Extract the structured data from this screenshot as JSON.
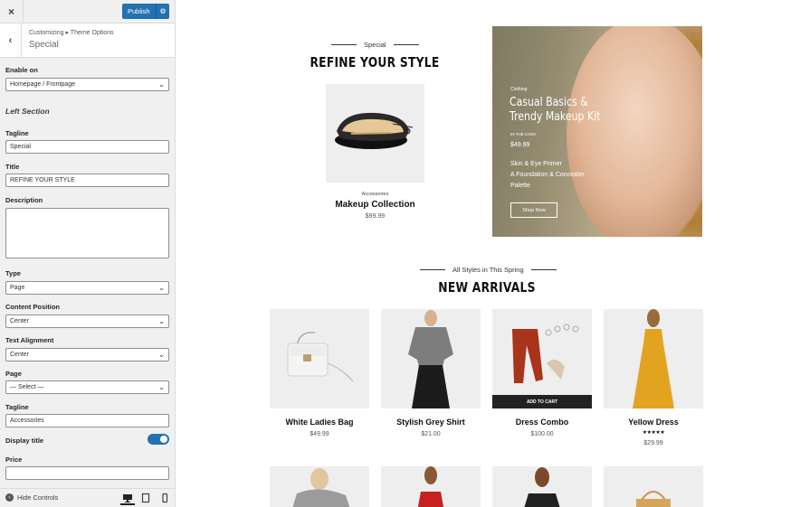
{
  "sidebar": {
    "close_icon": "×",
    "publish_label": "Publish",
    "breadcrumb": "Customizing ▸ Theme Options",
    "section_title": "Special",
    "enable_on": {
      "label": "Enable on",
      "value": "Homepage / Frontpage"
    },
    "left_section_heading": "Left Section",
    "tagline": {
      "label": "Tagline",
      "value": "Special"
    },
    "title": {
      "label": "Title",
      "value": "REFINE YOUR STYLE"
    },
    "description": {
      "label": "Description",
      "value": ""
    },
    "type": {
      "label": "Type",
      "value": "Page"
    },
    "content_position": {
      "label": "Content Position",
      "value": "Center"
    },
    "text_alignment": {
      "label": "Text Alignment",
      "value": "Center"
    },
    "page": {
      "label": "Page",
      "value": "— Select —"
    },
    "tagline2": {
      "label": "Tagline",
      "value": "Accessories"
    },
    "display_title": {
      "label": "Display title",
      "on": true
    },
    "price": {
      "label": "Price",
      "value": ""
    },
    "hide_controls": "Hide Controls"
  },
  "preview": {
    "special_tagline": "Special",
    "special_heading": "REFINE YOUR STYLE",
    "featured": {
      "category": "Accessories",
      "name": "Makeup Collection",
      "price": "$99.99"
    },
    "hero": {
      "category": "Clothing",
      "title_line1": "Casual Basics &",
      "title_line2": "Trendy Makeup Kit",
      "sub_label": "IN THE LOOK",
      "price": "$49.99",
      "feature1": "Skin & Eye Primer",
      "feature2": "A Foundation & Concealer",
      "feature3": "Palette",
      "button": "Shop Now"
    },
    "arrivals_tagline": "All Styles in This Spring",
    "arrivals_heading": "NEW ARRIVALS",
    "products": [
      {
        "name": "White Ladies Bag",
        "price": "$49.99"
      },
      {
        "name": "Stylish Grey Shirt",
        "price": "$21.00"
      },
      {
        "name": "Dress Combo",
        "price": "$100.00",
        "cta": "ADD TO CART"
      },
      {
        "name": "Yellow Dress",
        "price": "$29.99",
        "rating": "★★★★★"
      }
    ]
  },
  "colors": {
    "accent": "#2271b1",
    "sidebar_bg": "#f0f0f1",
    "hero_overlay": "#8a8268"
  }
}
